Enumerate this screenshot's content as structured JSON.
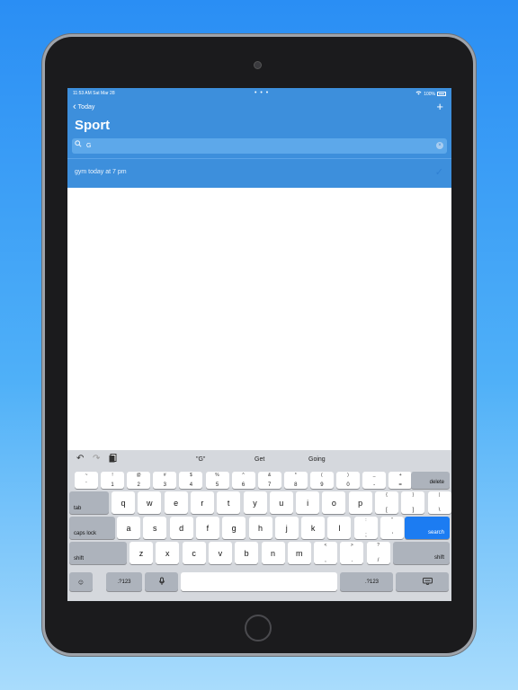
{
  "status_bar": {
    "time": "11:53 AM",
    "date": "Sat Mar 28",
    "dots": "• • •",
    "battery": "100%"
  },
  "nav": {
    "back_label": "Today",
    "title": "Sport",
    "add_icon": "plus-icon"
  },
  "search": {
    "value": "G",
    "placeholder": ""
  },
  "results": [
    {
      "label": "gym today at 7 pm",
      "checked": true
    }
  ],
  "keyboard": {
    "toolbar": {
      "icons": [
        "undo-icon",
        "redo-icon",
        "paste-icon"
      ],
      "suggestions": [
        "\"G\"",
        "Get",
        "Going"
      ]
    },
    "number_row": [
      {
        "top": "~",
        "bot": "`"
      },
      {
        "top": "!",
        "bot": "1"
      },
      {
        "top": "@",
        "bot": "2"
      },
      {
        "top": "#",
        "bot": "3"
      },
      {
        "top": "$",
        "bot": "4"
      },
      {
        "top": "%",
        "bot": "5"
      },
      {
        "top": "^",
        "bot": "6"
      },
      {
        "top": "&",
        "bot": "7"
      },
      {
        "top": "*",
        "bot": "8"
      },
      {
        "top": "(",
        "bot": "9"
      },
      {
        "top": ")",
        "bot": "0"
      },
      {
        "top": "_",
        "bot": "-"
      },
      {
        "top": "+",
        "bot": "="
      }
    ],
    "delete_label": "delete",
    "tab_label": "tab",
    "row_q": [
      "q",
      "w",
      "e",
      "r",
      "t",
      "y",
      "u",
      "i",
      "o",
      "p"
    ],
    "row_q_sym": [
      {
        "top": "{",
        "bot": "["
      },
      {
        "top": "}",
        "bot": "]"
      },
      {
        "top": "|",
        "bot": "\\"
      }
    ],
    "caps_label": "caps lock",
    "row_a": [
      "a",
      "s",
      "d",
      "f",
      "g",
      "h",
      "j",
      "k",
      "l"
    ],
    "row_a_sym": [
      {
        "top": ":",
        "bot": ";"
      },
      {
        "top": "\"",
        "bot": "'"
      }
    ],
    "search_label": "search",
    "shift_label": "shift",
    "row_z": [
      "z",
      "x",
      "c",
      "v",
      "b",
      "n",
      "m"
    ],
    "row_z_sym": [
      {
        "top": "<",
        "bot": ","
      },
      {
        "top": ">",
        "bot": "."
      },
      {
        "top": "?",
        "bot": "/"
      }
    ],
    "num_label": ".?123",
    "emoji_icon": "emoji-icon",
    "mic_icon": "microphone-icon",
    "hide_icon": "keyboard-hide-icon"
  },
  "colors": {
    "accent": "#3d8fdc",
    "key_blue": "#1c7cf2"
  }
}
